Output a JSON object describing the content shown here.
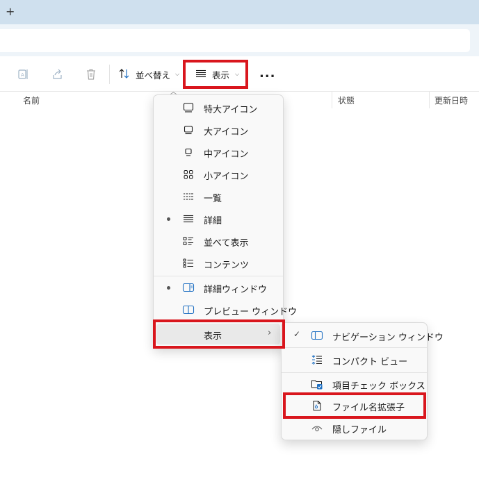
{
  "tabbar": {
    "new_tab_glyph": "+"
  },
  "toolbar": {
    "sort_label": "並べ替え",
    "view_label": "表示",
    "more_glyph": "..."
  },
  "columns": {
    "name": "名前",
    "status": "状態",
    "modified": "更新日時"
  },
  "view_menu": {
    "items": [
      {
        "label": "特大アイコン",
        "icon": "monitor-large-icon"
      },
      {
        "label": "大アイコン",
        "icon": "monitor-icon"
      },
      {
        "label": "中アイコン",
        "icon": "monitor-small-icon"
      },
      {
        "label": "小アイコン",
        "icon": "small-grid-icon"
      },
      {
        "label": "一覧",
        "icon": "list-columns-icon"
      },
      {
        "label": "詳細",
        "icon": "details-lines-icon",
        "selected": true
      },
      {
        "label": "並べて表示",
        "icon": "tiles-icon"
      },
      {
        "label": "コンテンツ",
        "icon": "content-list-icon"
      }
    ],
    "panes": [
      {
        "label": "詳細ウィンドウ",
        "icon": "details-pane-icon",
        "selected": true
      },
      {
        "label": "プレビュー ウィンドウ",
        "icon": "preview-pane-icon"
      }
    ],
    "show_label": "表示",
    "show_arrow": "›"
  },
  "show_menu": {
    "items": [
      {
        "label": "ナビゲーション ウィンドウ",
        "icon": "navigation-pane-icon",
        "checked": true
      },
      {
        "label": "コンパクト ビュー",
        "icon": "compact-view-icon"
      },
      {
        "label": "項目チェック ボックス",
        "icon": "checkbox-folder-icon"
      },
      {
        "label": "ファイル名拡張子",
        "icon": "file-extension-icon"
      },
      {
        "label": "隠しファイル",
        "icon": "eye-icon"
      }
    ],
    "check_glyph": "✓"
  },
  "colors": {
    "highlight": "#d9161d",
    "accent": "#1e6fc2",
    "tabbar": "#cfe0ee",
    "menu_bg": "#f9f9f9",
    "hover": "#e9e9e9"
  }
}
